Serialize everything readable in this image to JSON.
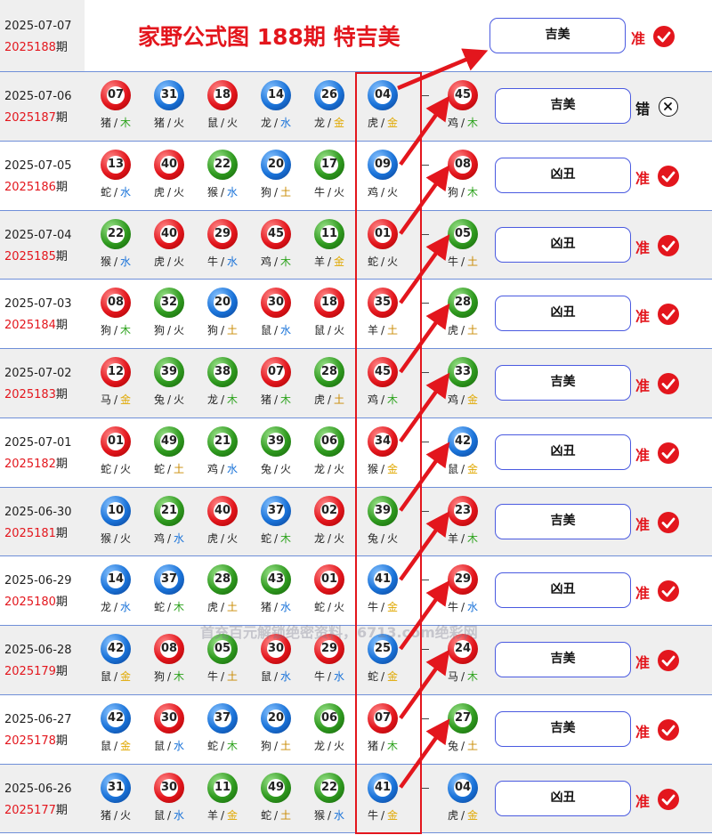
{
  "header": {
    "date": "2025-07-07",
    "issue": "2025188",
    "issue_suffix": "期",
    "title": "家野公式图 188期 特吉美",
    "result": "吉美",
    "verdict": "准",
    "status": "ok"
  },
  "rows": [
    {
      "date": "2025-07-06",
      "issue": "2025187",
      "issue_suffix": "期",
      "balls": [
        {
          "num": "07",
          "color": "red",
          "zodiac": "猪",
          "element": "木"
        },
        {
          "num": "31",
          "color": "blue",
          "zodiac": "猪",
          "element": "火"
        },
        {
          "num": "18",
          "color": "red",
          "zodiac": "鼠",
          "element": "火"
        },
        {
          "num": "14",
          "color": "blue",
          "zodiac": "龙",
          "element": "水"
        },
        {
          "num": "26",
          "color": "blue",
          "zodiac": "龙",
          "element": "金"
        },
        {
          "num": "04",
          "color": "blue",
          "zodiac": "虎",
          "element": "金"
        },
        {
          "num": "45",
          "color": "red",
          "zodiac": "鸡",
          "element": "木"
        }
      ],
      "result": "吉美",
      "verdict": "错",
      "status": "bad"
    },
    {
      "date": "2025-07-05",
      "issue": "2025186",
      "issue_suffix": "期",
      "balls": [
        {
          "num": "13",
          "color": "red",
          "zodiac": "蛇",
          "element": "水"
        },
        {
          "num": "40",
          "color": "red",
          "zodiac": "虎",
          "element": "火"
        },
        {
          "num": "22",
          "color": "green",
          "zodiac": "猴",
          "element": "水"
        },
        {
          "num": "20",
          "color": "blue",
          "zodiac": "狗",
          "element": "土"
        },
        {
          "num": "17",
          "color": "green",
          "zodiac": "牛",
          "element": "火"
        },
        {
          "num": "09",
          "color": "blue",
          "zodiac": "鸡",
          "element": "火"
        },
        {
          "num": "08",
          "color": "red",
          "zodiac": "狗",
          "element": "木"
        }
      ],
      "result": "凶丑",
      "verdict": "准",
      "status": "ok"
    },
    {
      "date": "2025-07-04",
      "issue": "2025185",
      "issue_suffix": "期",
      "balls": [
        {
          "num": "22",
          "color": "green",
          "zodiac": "猴",
          "element": "水"
        },
        {
          "num": "40",
          "color": "red",
          "zodiac": "虎",
          "element": "火"
        },
        {
          "num": "29",
          "color": "red",
          "zodiac": "牛",
          "element": "水"
        },
        {
          "num": "45",
          "color": "red",
          "zodiac": "鸡",
          "element": "木"
        },
        {
          "num": "11",
          "color": "green",
          "zodiac": "羊",
          "element": "金"
        },
        {
          "num": "01",
          "color": "red",
          "zodiac": "蛇",
          "element": "火"
        },
        {
          "num": "05",
          "color": "green",
          "zodiac": "牛",
          "element": "土"
        }
      ],
      "result": "凶丑",
      "verdict": "准",
      "status": "ok"
    },
    {
      "date": "2025-07-03",
      "issue": "2025184",
      "issue_suffix": "期",
      "balls": [
        {
          "num": "08",
          "color": "red",
          "zodiac": "狗",
          "element": "木"
        },
        {
          "num": "32",
          "color": "green",
          "zodiac": "狗",
          "element": "火"
        },
        {
          "num": "20",
          "color": "blue",
          "zodiac": "狗",
          "element": "土"
        },
        {
          "num": "30",
          "color": "red",
          "zodiac": "鼠",
          "element": "水"
        },
        {
          "num": "18",
          "color": "red",
          "zodiac": "鼠",
          "element": "火"
        },
        {
          "num": "35",
          "color": "red",
          "zodiac": "羊",
          "element": "土"
        },
        {
          "num": "28",
          "color": "green",
          "zodiac": "虎",
          "element": "土"
        }
      ],
      "result": "凶丑",
      "verdict": "准",
      "status": "ok"
    },
    {
      "date": "2025-07-02",
      "issue": "2025183",
      "issue_suffix": "期",
      "balls": [
        {
          "num": "12",
          "color": "red",
          "zodiac": "马",
          "element": "金"
        },
        {
          "num": "39",
          "color": "green",
          "zodiac": "兔",
          "element": "火"
        },
        {
          "num": "38",
          "color": "green",
          "zodiac": "龙",
          "element": "木"
        },
        {
          "num": "07",
          "color": "red",
          "zodiac": "猪",
          "element": "木"
        },
        {
          "num": "28",
          "color": "green",
          "zodiac": "虎",
          "element": "土"
        },
        {
          "num": "45",
          "color": "red",
          "zodiac": "鸡",
          "element": "木"
        },
        {
          "num": "33",
          "color": "green",
          "zodiac": "鸡",
          "element": "金"
        }
      ],
      "result": "吉美",
      "verdict": "准",
      "status": "ok"
    },
    {
      "date": "2025-07-01",
      "issue": "2025182",
      "issue_suffix": "期",
      "balls": [
        {
          "num": "01",
          "color": "red",
          "zodiac": "蛇",
          "element": "火"
        },
        {
          "num": "49",
          "color": "green",
          "zodiac": "蛇",
          "element": "土"
        },
        {
          "num": "21",
          "color": "green",
          "zodiac": "鸡",
          "element": "水"
        },
        {
          "num": "39",
          "color": "green",
          "zodiac": "兔",
          "element": "火"
        },
        {
          "num": "06",
          "color": "green",
          "zodiac": "龙",
          "element": "火"
        },
        {
          "num": "34",
          "color": "red",
          "zodiac": "猴",
          "element": "金"
        },
        {
          "num": "42",
          "color": "blue",
          "zodiac": "鼠",
          "element": "金"
        }
      ],
      "result": "凶丑",
      "verdict": "准",
      "status": "ok"
    },
    {
      "date": "2025-06-30",
      "issue": "2025181",
      "issue_suffix": "期",
      "balls": [
        {
          "num": "10",
          "color": "blue",
          "zodiac": "猴",
          "element": "火"
        },
        {
          "num": "21",
          "color": "green",
          "zodiac": "鸡",
          "element": "水"
        },
        {
          "num": "40",
          "color": "red",
          "zodiac": "虎",
          "element": "火"
        },
        {
          "num": "37",
          "color": "blue",
          "zodiac": "蛇",
          "element": "木"
        },
        {
          "num": "02",
          "color": "red",
          "zodiac": "龙",
          "element": "火"
        },
        {
          "num": "39",
          "color": "green",
          "zodiac": "兔",
          "element": "火"
        },
        {
          "num": "23",
          "color": "red",
          "zodiac": "羊",
          "element": "木"
        }
      ],
      "result": "吉美",
      "verdict": "准",
      "status": "ok"
    },
    {
      "date": "2025-06-29",
      "issue": "2025180",
      "issue_suffix": "期",
      "balls": [
        {
          "num": "14",
          "color": "blue",
          "zodiac": "龙",
          "element": "水"
        },
        {
          "num": "37",
          "color": "blue",
          "zodiac": "蛇",
          "element": "木"
        },
        {
          "num": "28",
          "color": "green",
          "zodiac": "虎",
          "element": "土"
        },
        {
          "num": "43",
          "color": "green",
          "zodiac": "猪",
          "element": "水"
        },
        {
          "num": "01",
          "color": "red",
          "zodiac": "蛇",
          "element": "火"
        },
        {
          "num": "41",
          "color": "blue",
          "zodiac": "牛",
          "element": "金"
        },
        {
          "num": "29",
          "color": "red",
          "zodiac": "牛",
          "element": "水"
        }
      ],
      "result": "凶丑",
      "verdict": "准",
      "status": "ok"
    },
    {
      "date": "2025-06-28",
      "issue": "2025179",
      "issue_suffix": "期",
      "balls": [
        {
          "num": "42",
          "color": "blue",
          "zodiac": "鼠",
          "element": "金"
        },
        {
          "num": "08",
          "color": "red",
          "zodiac": "狗",
          "element": "木"
        },
        {
          "num": "05",
          "color": "green",
          "zodiac": "牛",
          "element": "土"
        },
        {
          "num": "30",
          "color": "red",
          "zodiac": "鼠",
          "element": "水"
        },
        {
          "num": "29",
          "color": "red",
          "zodiac": "牛",
          "element": "水"
        },
        {
          "num": "25",
          "color": "blue",
          "zodiac": "蛇",
          "element": "金"
        },
        {
          "num": "24",
          "color": "red",
          "zodiac": "马",
          "element": "木"
        }
      ],
      "result": "吉美",
      "verdict": "准",
      "status": "ok"
    },
    {
      "date": "2025-06-27",
      "issue": "2025178",
      "issue_suffix": "期",
      "balls": [
        {
          "num": "42",
          "color": "blue",
          "zodiac": "鼠",
          "element": "金"
        },
        {
          "num": "30",
          "color": "red",
          "zodiac": "鼠",
          "element": "水"
        },
        {
          "num": "37",
          "color": "blue",
          "zodiac": "蛇",
          "element": "木"
        },
        {
          "num": "20",
          "color": "blue",
          "zodiac": "狗",
          "element": "土"
        },
        {
          "num": "06",
          "color": "green",
          "zodiac": "龙",
          "element": "火"
        },
        {
          "num": "07",
          "color": "red",
          "zodiac": "猪",
          "element": "木"
        },
        {
          "num": "27",
          "color": "green",
          "zodiac": "兔",
          "element": "土"
        }
      ],
      "result": "吉美",
      "verdict": "准",
      "status": "ok"
    },
    {
      "date": "2025-06-26",
      "issue": "2025177",
      "issue_suffix": "期",
      "balls": [
        {
          "num": "31",
          "color": "blue",
          "zodiac": "猪",
          "element": "火"
        },
        {
          "num": "30",
          "color": "red",
          "zodiac": "鼠",
          "element": "水"
        },
        {
          "num": "11",
          "color": "green",
          "zodiac": "羊",
          "element": "金"
        },
        {
          "num": "49",
          "color": "green",
          "zodiac": "蛇",
          "element": "土"
        },
        {
          "num": "22",
          "color": "green",
          "zodiac": "猴",
          "element": "水"
        },
        {
          "num": "41",
          "color": "blue",
          "zodiac": "牛",
          "element": "金"
        },
        {
          "num": "04",
          "color": "blue",
          "zodiac": "虎",
          "element": "金"
        }
      ],
      "result": "凶丑",
      "verdict": "准",
      "status": "ok"
    }
  ],
  "watermark": "首充百元解锁绝密资料，6713.com绝彩网",
  "separator": "/",
  "colors": {
    "red": "#e3161d",
    "blue": "#1a73d9",
    "green": "#2f9a1f",
    "border": "#4a5ae0"
  }
}
